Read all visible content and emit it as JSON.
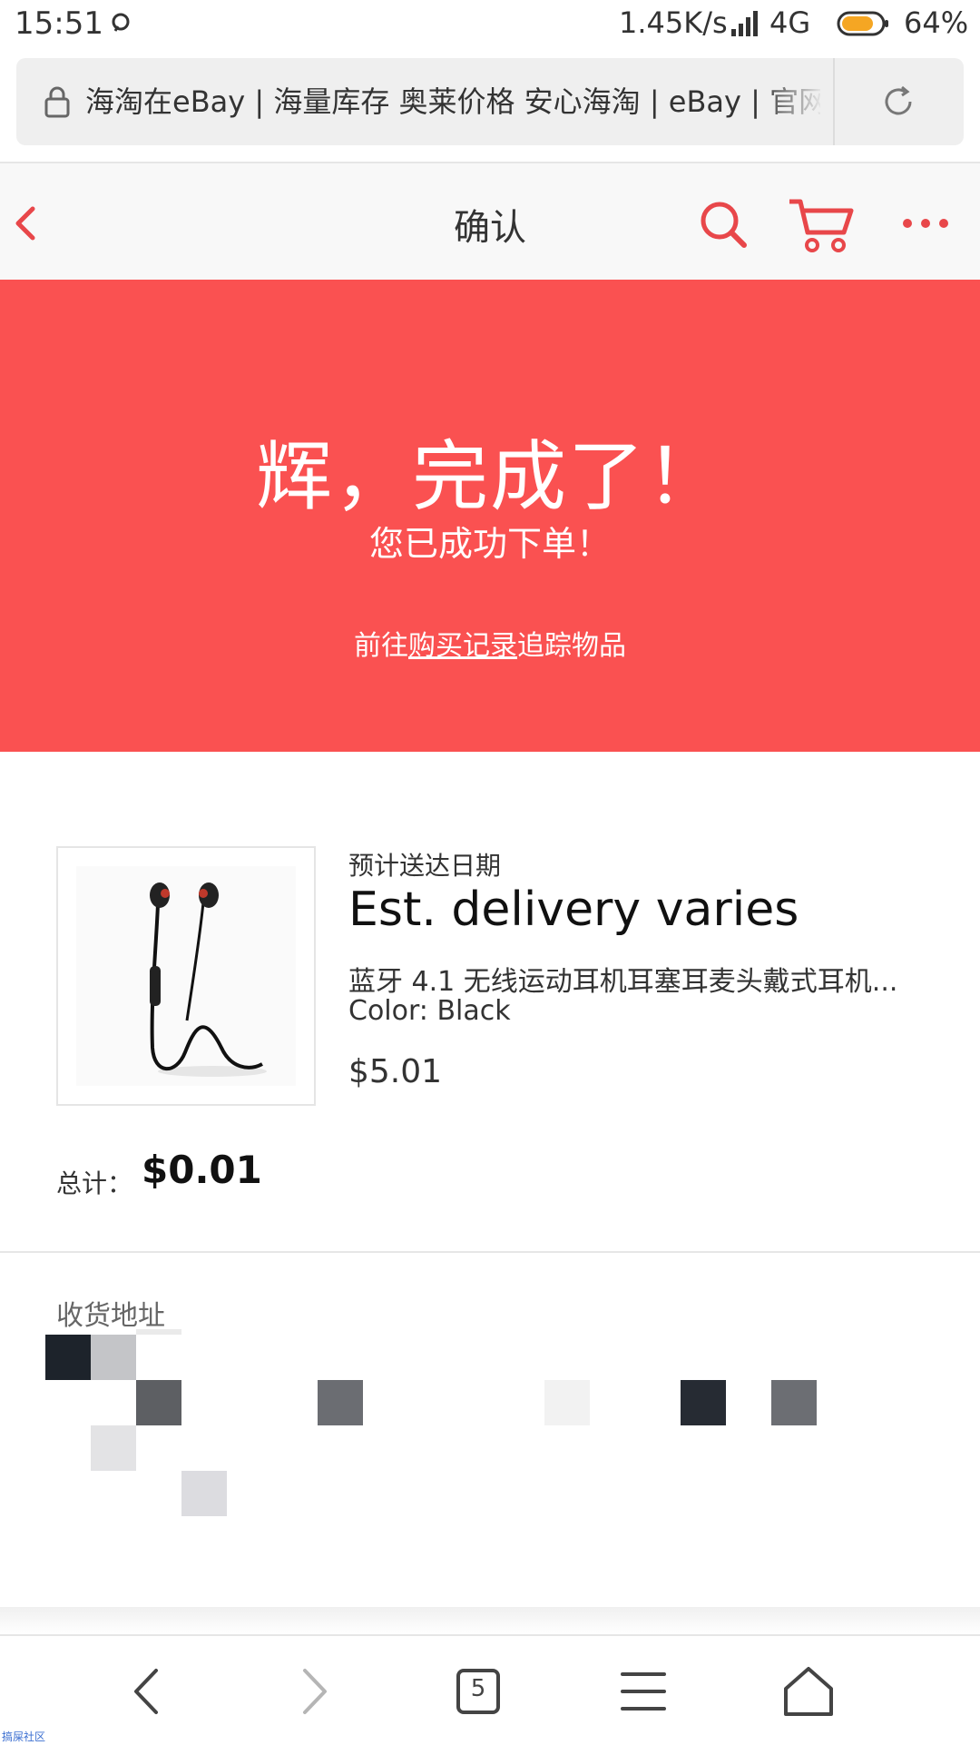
{
  "status_bar": {
    "time": "15:51",
    "net_speed": "1.45K/s",
    "network": "4G",
    "battery": "64%"
  },
  "browser": {
    "url_text": "海淘在eBay | 海量库存 奥莱价格 安心海淘 | eBay | 官网",
    "tab_count": "5"
  },
  "header": {
    "title": "确认"
  },
  "banner": {
    "headline": "辉，完成了！",
    "subtitle": "您已成功下单！",
    "track_prefix": "前往",
    "track_link": "购买记录",
    "track_suffix": "追踪物品"
  },
  "item": {
    "eta_label": "预计送达日期",
    "eta": "Est. delivery varies",
    "name": "蓝牙 4.1 无线运动耳机耳塞耳麦头戴式耳机...",
    "variant": "Color: Black",
    "price": "$5.01"
  },
  "total": {
    "label": "总计：",
    "value": "$0.01"
  },
  "address": {
    "label": "收货地址"
  },
  "watermark": "搞屎社区",
  "colors": {
    "brand_red": "#fa5151",
    "header_bg": "#f8f8f8",
    "text": "#222222"
  }
}
